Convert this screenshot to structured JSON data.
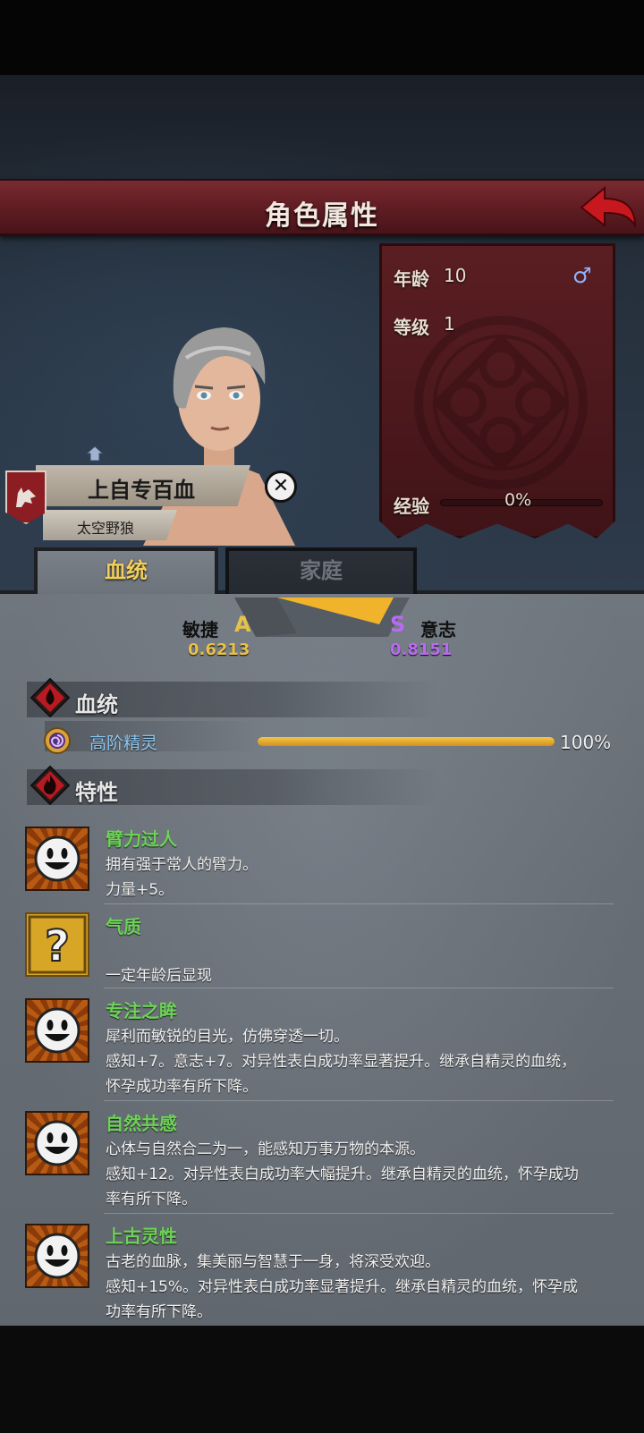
{
  "screen_title": "角色属性",
  "character": {
    "name": "上自专百血",
    "faction": "太空野狼",
    "age_label": "年龄",
    "age_value": "10",
    "gender_symbol": "♂",
    "level_label": "等级",
    "level_value": "1",
    "exp_label": "经验",
    "exp_value": "0%",
    "exp_progress": 0
  },
  "tabs": [
    {
      "label": "血统",
      "active": true
    },
    {
      "label": "家庭",
      "active": false
    }
  ],
  "stats": {
    "left": {
      "name": "敏捷",
      "grade": "A",
      "value": "0.6213",
      "color": "#e8c14a"
    },
    "right": {
      "name": "意志",
      "grade": "S",
      "value": "0.8151",
      "color": "#b86bf0"
    }
  },
  "bloodline_section": {
    "title": "血统",
    "items": [
      {
        "name": "高阶精灵",
        "percent_text": "100%",
        "progress": 1.0
      }
    ]
  },
  "traits_section": {
    "title": "特性",
    "items": [
      {
        "icon": "smile-face-icon",
        "name": "臂力过人",
        "lines": [
          "拥有强于常人的臂力。",
          "力量+5。"
        ]
      },
      {
        "icon": "question-mark-icon",
        "name": "气质",
        "lines": [
          "",
          "一定年龄后显现"
        ]
      },
      {
        "icon": "smile-face-icon",
        "name": "专注之眸",
        "lines": [
          "犀利而敏锐的目光，仿佛穿透一切。",
          "感知+7。意志+7。对异性表白成功率显著提升。继承自精灵的血统，",
          "怀孕成功率有所下降。"
        ]
      },
      {
        "icon": "smile-face-icon",
        "name": "自然共感",
        "lines": [
          "心体与自然合二为一，能感知万事万物的本源。",
          "感知+12。对异性表白成功率大幅提升。继承自精灵的血统，怀孕成功",
          "率有所下降。"
        ]
      },
      {
        "icon": "smile-face-icon",
        "name": "上古灵性",
        "lines": [
          "古老的血脉，集美丽与智慧于一身，将深受欢迎。",
          "感知+15%。对异性表白成功率显著提升。继承自精灵的血统，怀孕成",
          "功率有所下降。"
        ]
      }
    ]
  },
  "colors": {
    "banner_red": "#5d1c22",
    "tab_active_text": "#f1cf5a",
    "trait_name": "#6dd357",
    "bloodline_name": "#8cc6f0"
  }
}
